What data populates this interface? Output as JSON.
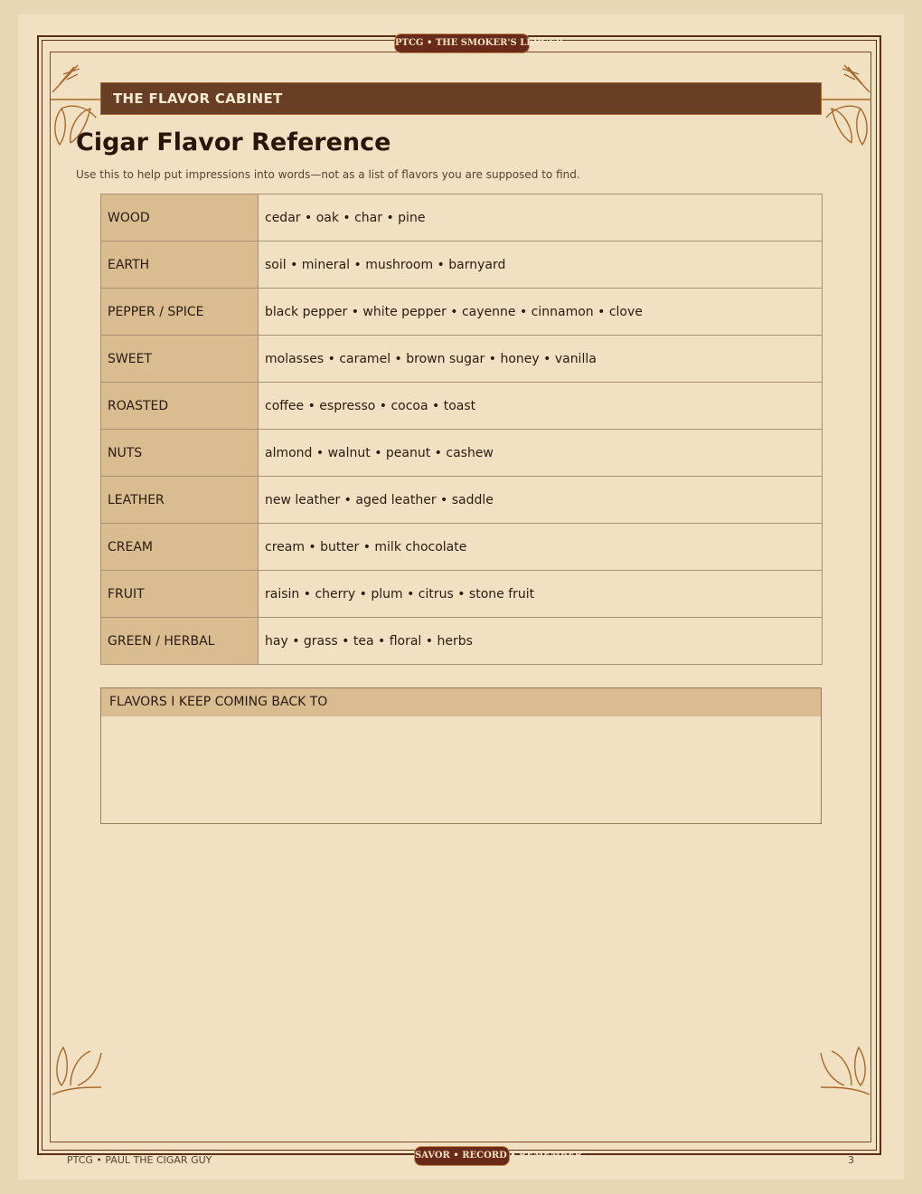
{
  "top_badge": "PTCG  •  THE SMOKER'S LEDGER",
  "bottom_badge": "SAVOR • RECORD • REMEMBER",
  "section_label": "THE FLAVOR CABINET",
  "title": "Cigar Flavor Reference",
  "subtitle": "Use this to help put impressions into words—not as a list of flavors you are supposed to find.",
  "flavors": [
    {
      "category": "WOOD",
      "items": "cedar • oak • char • pine"
    },
    {
      "category": "EARTH",
      "items": "soil • mineral • mushroom • barnyard"
    },
    {
      "category": "PEPPER / SPICE",
      "items": "black pepper • white pepper • cayenne • cinnamon • clove"
    },
    {
      "category": "SWEET",
      "items": "molasses • caramel • brown sugar • honey • vanilla"
    },
    {
      "category": "ROASTED",
      "items": "coffee • espresso • cocoa • toast"
    },
    {
      "category": "NUTS",
      "items": "almond • walnut • peanut • cashew"
    },
    {
      "category": "LEATHER",
      "items": "new leather • aged leather • saddle"
    },
    {
      "category": "CREAM",
      "items": "cream • butter • milk chocolate"
    },
    {
      "category": "FRUIT",
      "items": "raisin • cherry • plum • citrus • stone fruit"
    },
    {
      "category": "GREEN / HERBAL",
      "items": "hay • grass • tea • floral • herbs"
    }
  ],
  "notes_heading": "FLAVORS I KEEP COMING BACK TO",
  "footer_left": "PTCG  •  PAUL THE CIGAR GUY",
  "page_number": "3",
  "colors": {
    "background": "#f1e1c2",
    "header_bar": "#683e24",
    "category_fill": "#d9bd90",
    "frame": "#5a2e17",
    "badge": "#6a2a1a",
    "ornament": "#a8682a"
  },
  "icons": [
    "tobacco-leaf-ornament-icon"
  ]
}
